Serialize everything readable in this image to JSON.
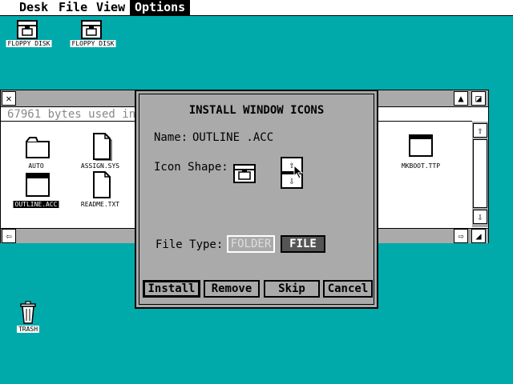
{
  "menubar": {
    "items": [
      "Desk",
      "File",
      "View",
      "Options"
    ],
    "active": "Options"
  },
  "desktop": {
    "drives": [
      {
        "label": "FLOPPY DISK"
      },
      {
        "label": "FLOPPY DISK"
      }
    ],
    "trash": {
      "label": "TRASH"
    }
  },
  "window": {
    "info": "67961 bytes used in",
    "files": [
      {
        "name": "AUTO",
        "kind": "folder"
      },
      {
        "name": "ASSIGN.SYS",
        "kind": "document"
      },
      {
        "name": "OUTLINE.ACC",
        "kind": "program",
        "selected": true
      },
      {
        "name": "README.TXT",
        "kind": "document"
      },
      {
        "name": "MKBOOT.TTP",
        "kind": "program"
      }
    ],
    "controls": {
      "close": "close-box",
      "fuller": "fuller-box",
      "up": "⇧",
      "down": "⇩",
      "left": "⇦",
      "right": "⇨"
    }
  },
  "dialog": {
    "title": "INSTALL WINDOW ICONS",
    "name_label": "Name:",
    "name_value": "OUTLINE .ACC",
    "icon_shape_label": "Icon Shape:",
    "file_type_label": "File Type:",
    "file_type_options": [
      "FOLDER",
      "FILE"
    ],
    "file_type_selected": "FILE",
    "buttons": {
      "install": "Install",
      "remove": "Remove",
      "skip": "Skip",
      "cancel": "Cancel"
    }
  },
  "colors": {
    "desktop": "#00aaaa",
    "dialog": "#aaaaaa",
    "selected": "#555555"
  }
}
